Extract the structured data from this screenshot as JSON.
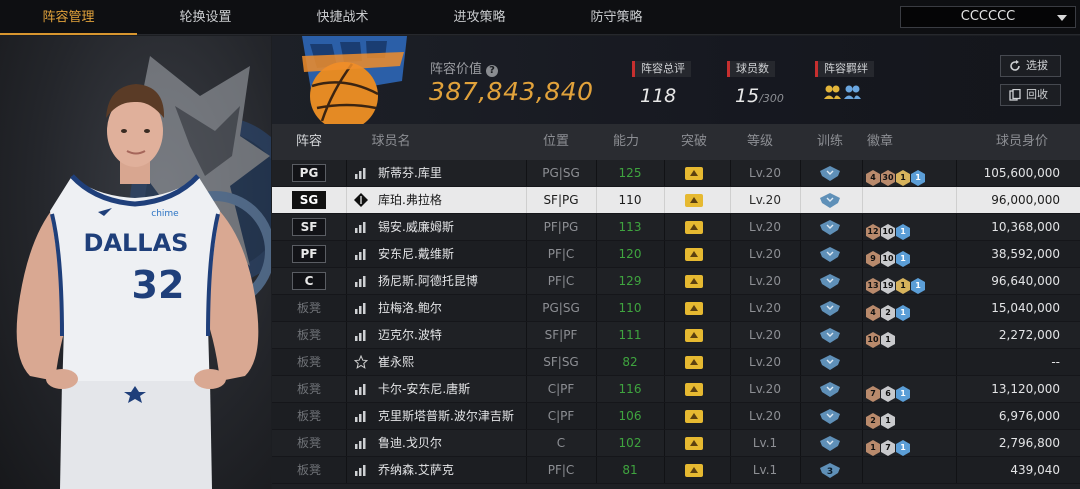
{
  "nav": {
    "tabs": [
      "阵容管理",
      "轮换设置",
      "快捷战术",
      "进攻策略",
      "防守策略"
    ],
    "active_index": 0,
    "team_select_value": "CCCCCC"
  },
  "player_panel": {
    "jersey_team": "DALLAS",
    "jersey_number": "32",
    "jersey_sponsor": "chime"
  },
  "header": {
    "value_label": "阵容价值",
    "help_icon": "?",
    "value": "387,843,840",
    "rating_label": "阵容总评",
    "rating_value": "118",
    "players_label": "球员数",
    "players_value": "15",
    "players_max": "/300",
    "synergy_label": "阵容羁绊",
    "btn_select": "选拔",
    "btn_recycle": "回收"
  },
  "table": {
    "headers": [
      "阵容",
      "球员名",
      "位置",
      "能力",
      "突破",
      "等级",
      "训练",
      "徽章",
      "球员身价"
    ],
    "rows": [
      {
        "slot": "PG",
        "starter": true,
        "name": "斯蒂芬.库里",
        "pos": "PG|SG",
        "ovr": "125",
        "lv": "Lv.20",
        "train": "",
        "badges": [
          [
            "bronze",
            "4"
          ],
          [
            "bronze",
            "30"
          ],
          [
            "gold",
            "1"
          ],
          [
            "blue",
            "1"
          ]
        ],
        "salary": "105,600,000",
        "selected": false
      },
      {
        "slot": "SG",
        "starter": true,
        "name": "库珀.弗拉格",
        "pos": "SF|PG",
        "ovr": "110",
        "lv": "Lv.20",
        "train": "",
        "badges": [],
        "salary": "96,000,000",
        "selected": true
      },
      {
        "slot": "SF",
        "starter": true,
        "name": "锡安.威廉姆斯",
        "pos": "PF|PG",
        "ovr": "113",
        "lv": "Lv.20",
        "train": "",
        "badges": [
          [
            "bronze",
            "12"
          ],
          [
            "silver",
            "10"
          ],
          [
            "blue",
            "1"
          ]
        ],
        "salary": "10,368,000",
        "selected": false
      },
      {
        "slot": "PF",
        "starter": true,
        "name": "安东尼.戴维斯",
        "pos": "PF|C",
        "ovr": "120",
        "lv": "Lv.20",
        "train": "",
        "badges": [
          [
            "bronze",
            "9"
          ],
          [
            "silver",
            "10"
          ],
          [
            "blue",
            "1"
          ]
        ],
        "salary": "38,592,000",
        "selected": false
      },
      {
        "slot": "C",
        "starter": true,
        "name": "扬尼斯.阿德托昆博",
        "pos": "PF|C",
        "ovr": "129",
        "lv": "Lv.20",
        "train": "",
        "badges": [
          [
            "bronze",
            "13"
          ],
          [
            "silver",
            "19"
          ],
          [
            "gold",
            "1"
          ],
          [
            "blue",
            "1"
          ]
        ],
        "salary": "96,640,000",
        "selected": false
      },
      {
        "slot": "板凳",
        "starter": false,
        "name": "拉梅洛.鲍尔",
        "pos": "PG|SG",
        "ovr": "110",
        "lv": "Lv.20",
        "train": "",
        "badges": [
          [
            "bronze",
            "4"
          ],
          [
            "silver",
            "2"
          ],
          [
            "blue",
            "1"
          ]
        ],
        "salary": "15,040,000",
        "selected": false
      },
      {
        "slot": "板凳",
        "starter": false,
        "name": "迈克尔.波特",
        "pos": "SF|PF",
        "ovr": "111",
        "lv": "Lv.20",
        "train": "",
        "badges": [
          [
            "bronze",
            "10"
          ],
          [
            "silver",
            "1"
          ]
        ],
        "salary": "2,272,000",
        "selected": false
      },
      {
        "slot": "板凳",
        "starter": false,
        "name": "崔永熙",
        "pos": "SF|SG",
        "ovr": "82",
        "lv": "Lv.20",
        "train": "",
        "badges": [],
        "salary": "--",
        "selected": false
      },
      {
        "slot": "板凳",
        "starter": false,
        "name": "卡尔-安东尼.唐斯",
        "pos": "C|PF",
        "ovr": "116",
        "lv": "Lv.20",
        "train": "",
        "badges": [
          [
            "bronze",
            "7"
          ],
          [
            "silver",
            "6"
          ],
          [
            "blue",
            "1"
          ]
        ],
        "salary": "13,120,000",
        "selected": false
      },
      {
        "slot": "板凳",
        "starter": false,
        "name": "克里斯塔普斯.波尔津吉斯",
        "pos": "C|PF",
        "ovr": "106",
        "lv": "Lv.20",
        "train": "",
        "badges": [
          [
            "bronze",
            "2"
          ],
          [
            "silver",
            "1"
          ]
        ],
        "salary": "6,976,000",
        "selected": false
      },
      {
        "slot": "板凳",
        "starter": false,
        "name": "鲁迪.戈贝尔",
        "pos": "C",
        "ovr": "102",
        "lv": "Lv.1",
        "train": "",
        "badges": [
          [
            "bronze",
            "1"
          ],
          [
            "silver",
            "7"
          ],
          [
            "blue",
            "1"
          ]
        ],
        "salary": "2,796,800",
        "selected": false
      },
      {
        "slot": "板凳",
        "starter": false,
        "name": "乔纳森.艾萨克",
        "pos": "PF|C",
        "ovr": "81",
        "lv": "Lv.1",
        "train": "3",
        "badges": [],
        "salary": "439,040",
        "selected": false
      }
    ]
  },
  "colors": {
    "accent": "#e1a23b",
    "rating_green": "#3fa43f",
    "label_red": "#c62f2f"
  }
}
